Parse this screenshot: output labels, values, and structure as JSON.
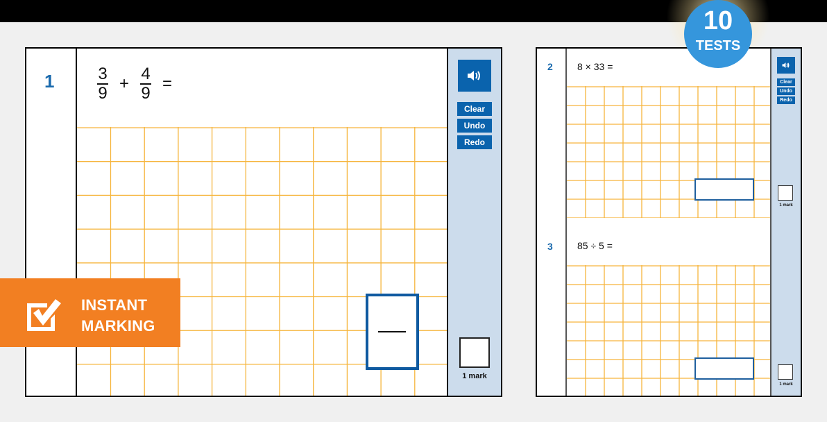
{
  "colors": {
    "accent_blue": "#0a63ad",
    "question_number": "#1a6aad",
    "grid_line": "#f6b53c",
    "sidebar_bg": "#ccdcec",
    "badge_orange": "#f27f22",
    "tests_badge_blue": "#3596dc"
  },
  "promo": {
    "tests_count": "10",
    "tests_label": "TESTS",
    "instant_marking_line1": "INSTANT",
    "instant_marking_line2": "MARKING",
    "instant_marking_icon": "checkbox-check-icon"
  },
  "question_1": {
    "number": "1",
    "fraction_a": {
      "numerator": "3",
      "denominator": "9"
    },
    "operator": "+",
    "fraction_b": {
      "numerator": "4",
      "denominator": "9"
    },
    "equals": "=",
    "answer_type": "fraction",
    "audio_icon": "speaker-icon",
    "buttons": {
      "clear": "Clear",
      "undo": "Undo",
      "redo": "Redo"
    },
    "mark_label": "1 mark"
  },
  "question_2": {
    "number": "2",
    "text": "8 × 33 =",
    "audio_icon": "speaker-icon",
    "buttons": {
      "clear": "Clear",
      "undo": "Undo",
      "redo": "Redo"
    },
    "mark_label": "1 mark"
  },
  "question_3": {
    "number": "3",
    "text": "85 ÷ 5 =",
    "mark_label": "1 mark"
  }
}
